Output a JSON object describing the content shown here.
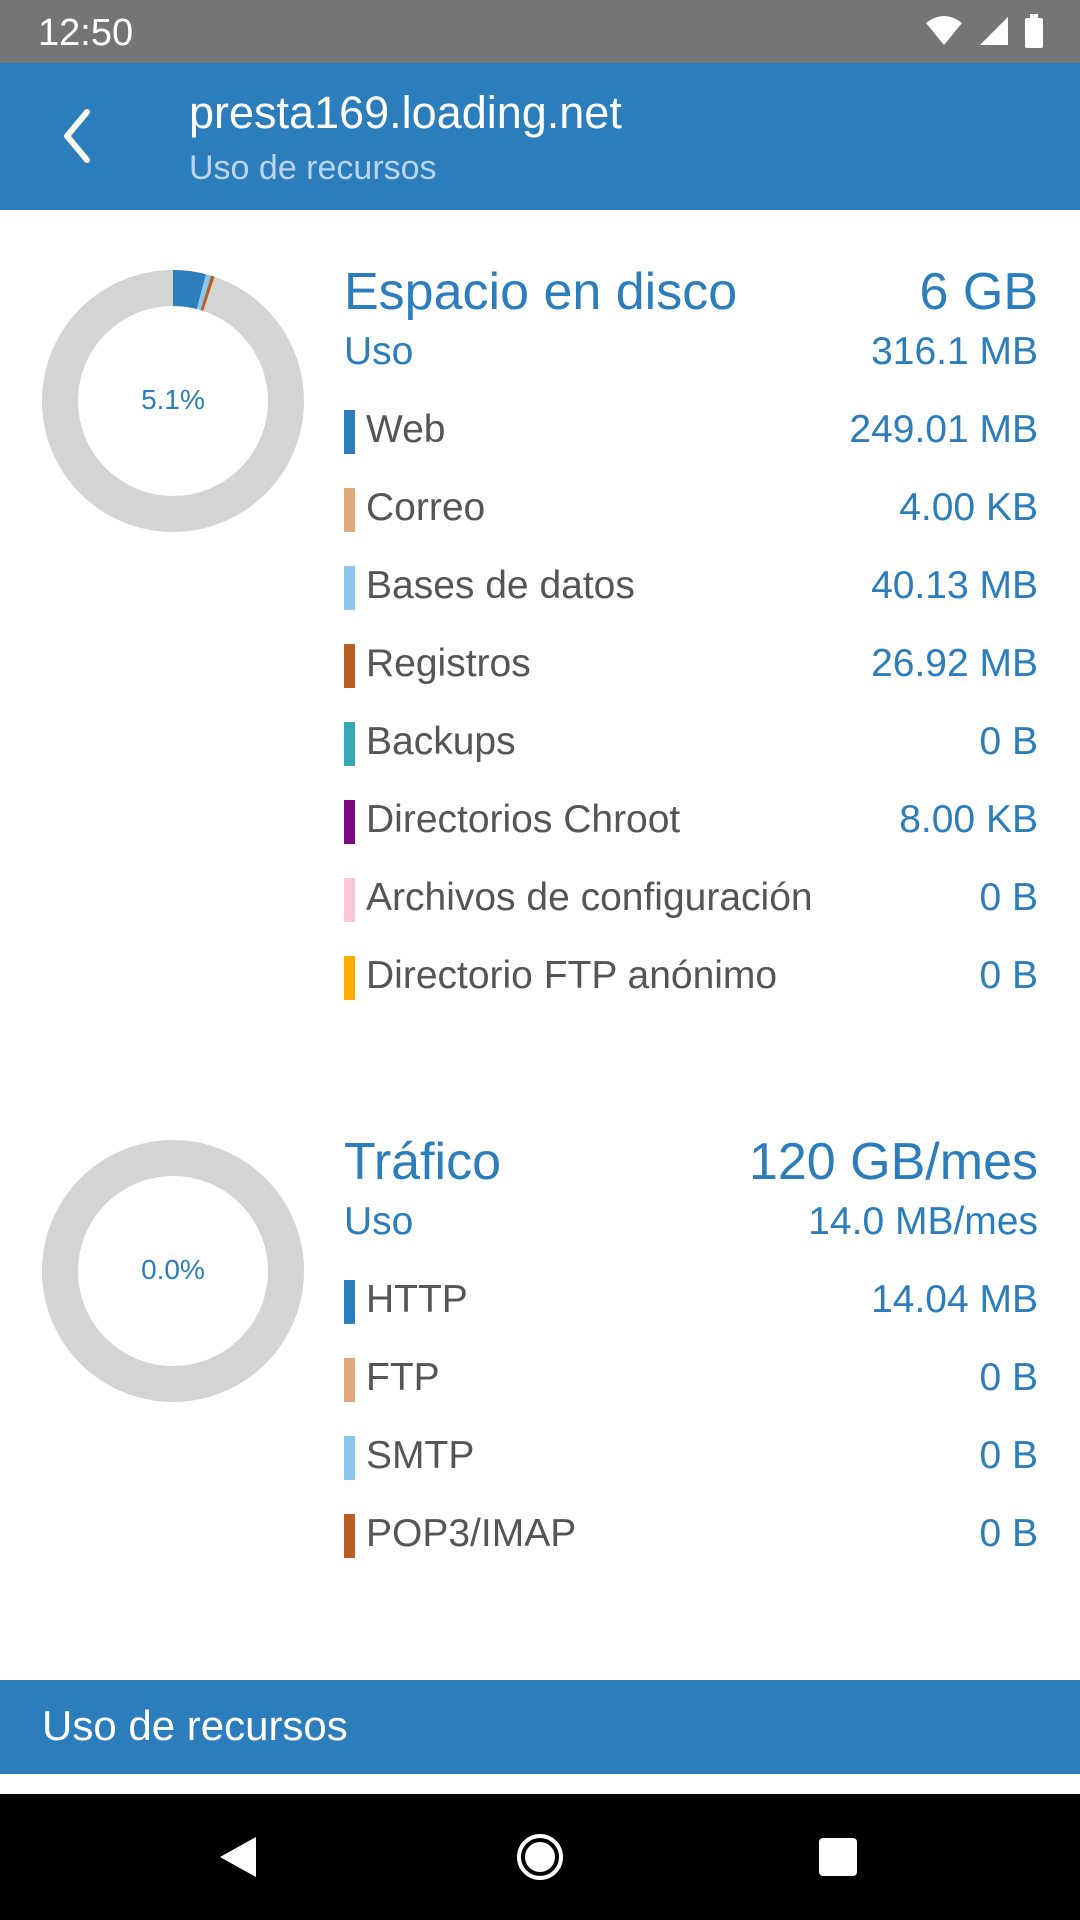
{
  "status_bar": {
    "time": "12:50"
  },
  "app_bar": {
    "title": "presta169.loading.net",
    "subtitle": "Uso de recursos"
  },
  "disk": {
    "title": "Espacio en disco",
    "total": "6 GB",
    "use_label": "Uso",
    "use_value": "316.1 MB",
    "percent_label": "5.1%",
    "items": [
      {
        "label": "Web",
        "value": "249.01 MB",
        "color": "#2b7dbb",
        "fraction": 0.0405
      },
      {
        "label": "Correo",
        "value": "4.00 KB",
        "color": "#e0a97a",
        "fraction": 0.0
      },
      {
        "label": "Bases de datos",
        "value": "40.13 MB",
        "color": "#8cc8ee",
        "fraction": 0.0065
      },
      {
        "label": "Registros",
        "value": "26.92 MB",
        "color": "#b85e25",
        "fraction": 0.0044
      },
      {
        "label": "Backups",
        "value": "0 B",
        "color": "#3aa7b4",
        "fraction": 0.0
      },
      {
        "label": "Directorios Chroot",
        "value": "8.00 KB",
        "color": "#7e0a82",
        "fraction": 0.0
      },
      {
        "label": "Archivos de configuración",
        "value": "0 B",
        "color": "#ffc6d4",
        "fraction": 0.0
      },
      {
        "label": "Directorio FTP anónimo",
        "value": "0 B",
        "color": "#ffab00",
        "fraction": 0.0
      }
    ]
  },
  "traffic": {
    "title": "Tráfico",
    "total": "120 GB/mes",
    "use_label": "Uso",
    "use_value": "14.0 MB/mes",
    "percent_label": "0.0%",
    "items": [
      {
        "label": "HTTP",
        "value": "14.04 MB",
        "color": "#2b7dbb",
        "fraction": 0.0
      },
      {
        "label": "FTP",
        "value": "0 B",
        "color": "#e0a97a",
        "fraction": 0.0
      },
      {
        "label": "SMTP",
        "value": "0 B",
        "color": "#8cc8ee",
        "fraction": 0.0
      },
      {
        "label": "POP3/IMAP",
        "value": "0 B",
        "color": "#b85e25",
        "fraction": 0.0
      }
    ]
  },
  "bottom_bar": {
    "title": "Uso de recursos"
  },
  "colors": {
    "accent": "#2b7dbb",
    "donut_track": "#d4d4d4"
  },
  "icons": {
    "back": "chevron-left-icon",
    "wifi": "wifi-icon",
    "signal": "signal-icon",
    "battery": "battery-icon",
    "nav_back": "triangle-back-icon",
    "nav_home": "circle-home-icon",
    "nav_recents": "square-recents-icon"
  }
}
